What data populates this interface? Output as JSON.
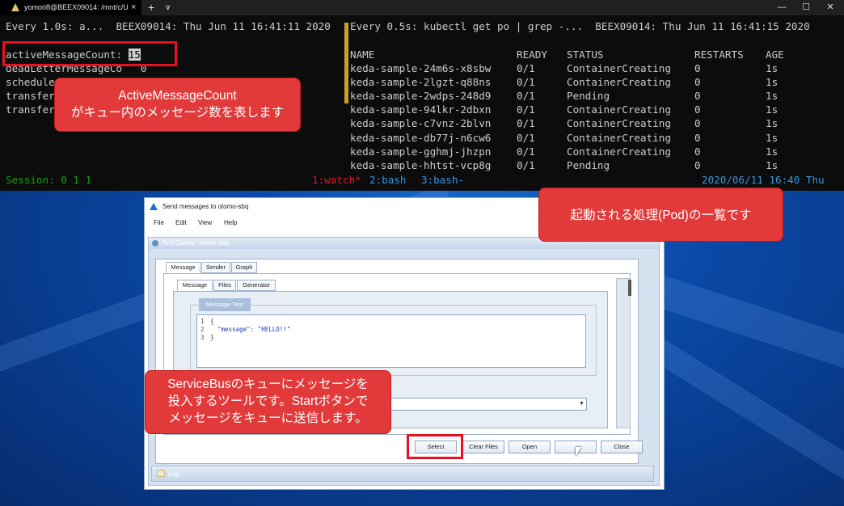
{
  "terminal": {
    "tab_title": "yomori8@BEEX09014: /mnt/c/U",
    "tab_close": "×",
    "tab_new": "+",
    "tab_dropdown": "∨",
    "window_controls": {
      "minimize": "—",
      "maximize": "☐",
      "close": "✕"
    },
    "left_pane": {
      "header": "Every 1.0s: a...  BEEX09014: Thu Jun 11 16:41:11 2020",
      "lines": [
        {
          "label": "activeMessageCount:",
          "value": "15"
        },
        {
          "label": "deadLetterMessageCo",
          "value": "0"
        },
        {
          "label": "schedule",
          "value": ""
        },
        {
          "label": "transfer",
          "value": ""
        },
        {
          "label": "transfer",
          "value": ""
        }
      ]
    },
    "right_pane": {
      "header": "Every 0.5s: kubectl get po | grep -...  BEEX09014: Thu Jun 11 16:41:15 2020",
      "columns": [
        "NAME",
        "READY",
        "STATUS",
        "RESTARTS",
        "AGE"
      ],
      "rows": [
        [
          "keda-sample-24m6s-x8sbw",
          "0/1",
          "ContainerCreating",
          "0",
          "1s"
        ],
        [
          "keda-sample-2lgzt-q88ns",
          "0/1",
          "ContainerCreating",
          "0",
          "1s"
        ],
        [
          "keda-sample-2wdps-248d9",
          "0/1",
          "Pending",
          "0",
          "1s"
        ],
        [
          "keda-sample-94lkr-2dbxn",
          "0/1",
          "ContainerCreating",
          "0",
          "1s"
        ],
        [
          "keda-sample-c7vnz-2blvn",
          "0/1",
          "ContainerCreating",
          "0",
          "1s"
        ],
        [
          "keda-sample-db77j-n6cw6",
          "0/1",
          "ContainerCreating",
          "0",
          "1s"
        ],
        [
          "keda-sample-gghmj-jhzpn",
          "0/1",
          "ContainerCreating",
          "0",
          "1s"
        ],
        [
          "keda-sample-hhtst-vcp8g",
          "0/1",
          "Pending",
          "0",
          "1s"
        ]
      ]
    },
    "status_bar": {
      "session": "Session: 0 1 1",
      "window1": "1:watch*",
      "window2": "2:bash",
      "window3": "3:bash-",
      "datetime": "2020/06/11 16:40 Thu"
    }
  },
  "callouts": {
    "active_count": [
      "ActiveMessageCount",
      "がキュー内のメッセージ数を表します"
    ],
    "pods": "起動される処理(Pod)の一覧です",
    "tool": [
      "ServiceBusのキューにメッセージを",
      "投入するツールです。Startボタンで",
      "メッセージをキューに送信します。"
    ]
  },
  "explorer": {
    "title": "Send messages to otomo-sbq",
    "menu": [
      "File",
      "Edit",
      "View",
      "Help"
    ],
    "panel_header": "Test Queue: otomo-sbq",
    "tabs_top": [
      "Message",
      "Sender",
      "Graph"
    ],
    "tabs_sub": [
      "Message",
      "Files",
      "Generator"
    ],
    "group_title": "Message Text",
    "editor_lines": [
      "1",
      "2",
      "3"
    ],
    "editor_code": [
      "{",
      "  \"message\": \"HELLO!!\"",
      "}"
    ],
    "buttons": {
      "select": "Select",
      "clear_files": "Clear Files",
      "open": "Open",
      "blank": "",
      "close": "Close"
    },
    "log_label": "Log"
  }
}
